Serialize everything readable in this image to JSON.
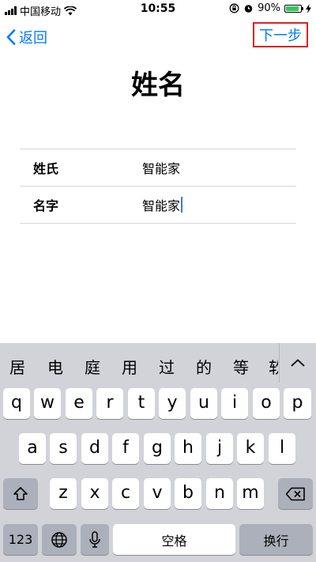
{
  "status_bar": {
    "carrier": "中国移动",
    "time": "10:55",
    "battery_percent": "90%",
    "battery_level": 0.9,
    "battery_color": "#34c759"
  },
  "nav": {
    "back_label": "返回",
    "next_label": "下一步"
  },
  "page": {
    "title": "姓名"
  },
  "form": {
    "rows": [
      {
        "label": "姓氏",
        "value": "智能家"
      },
      {
        "label": "名字",
        "value": "智能家"
      }
    ]
  },
  "keyboard": {
    "candidates": [
      "居",
      "电",
      "庭",
      "用",
      "过",
      "的",
      "等",
      "软"
    ],
    "row1": [
      "q",
      "w",
      "e",
      "r",
      "t",
      "y",
      "u",
      "i",
      "o",
      "p"
    ],
    "row2": [
      "a",
      "s",
      "d",
      "f",
      "g",
      "h",
      "j",
      "k",
      "l"
    ],
    "row3": [
      "z",
      "x",
      "c",
      "v",
      "b",
      "n",
      "m"
    ],
    "numbers_label": "123",
    "space_label": "空格",
    "return_label": "换行"
  },
  "colors": {
    "accent": "#007aff",
    "highlight_border": "#e02020"
  },
  "icons": [
    "wifi-icon",
    "rotation-lock-icon",
    "alarm-icon",
    "charging-icon",
    "chevron-left-icon",
    "chevron-up-icon",
    "shift-icon",
    "delete-icon",
    "globe-icon",
    "microphone-icon"
  ]
}
